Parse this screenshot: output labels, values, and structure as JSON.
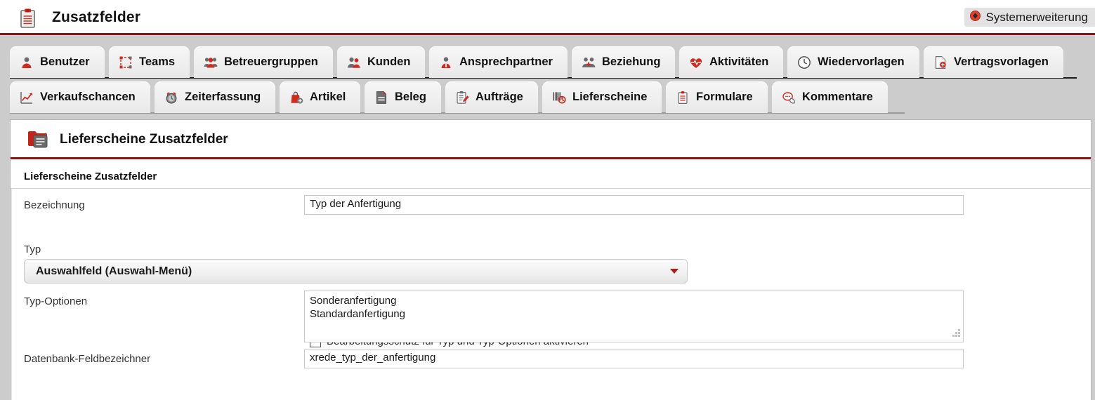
{
  "titlebar": {
    "icon": "clipboard-icon",
    "title": "Zusatzfelder",
    "badge": {
      "icon": "system-extension-icon",
      "label": "Systemerweiterung"
    }
  },
  "tabs": {
    "row1": [
      {
        "label": "Benutzer",
        "icon": "user-icon"
      },
      {
        "label": "Teams",
        "icon": "teams-frame-icon"
      },
      {
        "label": "Betreuergruppen",
        "icon": "user-group-icon"
      },
      {
        "label": "Kunden",
        "icon": "customers-icon"
      },
      {
        "label": "Ansprechpartner",
        "icon": "contact-person-icon"
      },
      {
        "label": "Beziehung",
        "icon": "relationship-icon"
      },
      {
        "label": "Aktivitäten",
        "icon": "heart-pulse-icon"
      },
      {
        "label": "Wiedervorlagen",
        "icon": "clock-icon"
      },
      {
        "label": "Vertragsvorlagen",
        "icon": "contract-template-icon"
      }
    ],
    "row2": [
      {
        "label": "Verkaufschancen",
        "icon": "chart-line-icon"
      },
      {
        "label": "Zeiterfassung",
        "icon": "alarm-clock-icon"
      },
      {
        "label": "Artikel",
        "icon": "article-bag-icon"
      },
      {
        "label": "Beleg",
        "icon": "document-icon"
      },
      {
        "label": "Aufträge",
        "icon": "order-clipboard-icon"
      },
      {
        "label": "Lieferscheine",
        "icon": "barcode-scan-icon"
      },
      {
        "label": "Formulare",
        "icon": "form-clipboard-icon"
      },
      {
        "label": "Kommentare",
        "icon": "comment-bubble-icon"
      }
    ]
  },
  "panel": {
    "icon": "red-folder-document-icon",
    "title": "Lieferscheine Zusatzfelder",
    "section_title": "Lieferscheine Zusatzfelder",
    "fields": {
      "bezeichnung": {
        "label": "Bezeichnung",
        "value": "Typ der Anfertigung"
      },
      "schutz_checkbox": {
        "label": "Bearbeitungsschutz für Typ und Typ-Optionen aktivieren",
        "checked": false
      },
      "typ": {
        "label": "Typ",
        "value": "Auswahlfeld (Auswahl-Menü)"
      },
      "typ_optionen": {
        "label": "Typ-Optionen",
        "value": "Sonderanfertigung\nStandardanfertigung"
      },
      "feldbezeichner": {
        "label": "Datenbank-Feldbezeichner",
        "value": "xrede_typ_der_anfertigung"
      }
    }
  },
  "colors": {
    "accent_red": "#8c1616",
    "icon_red": "#d02b1f",
    "page_bg": "#cccccc"
  }
}
